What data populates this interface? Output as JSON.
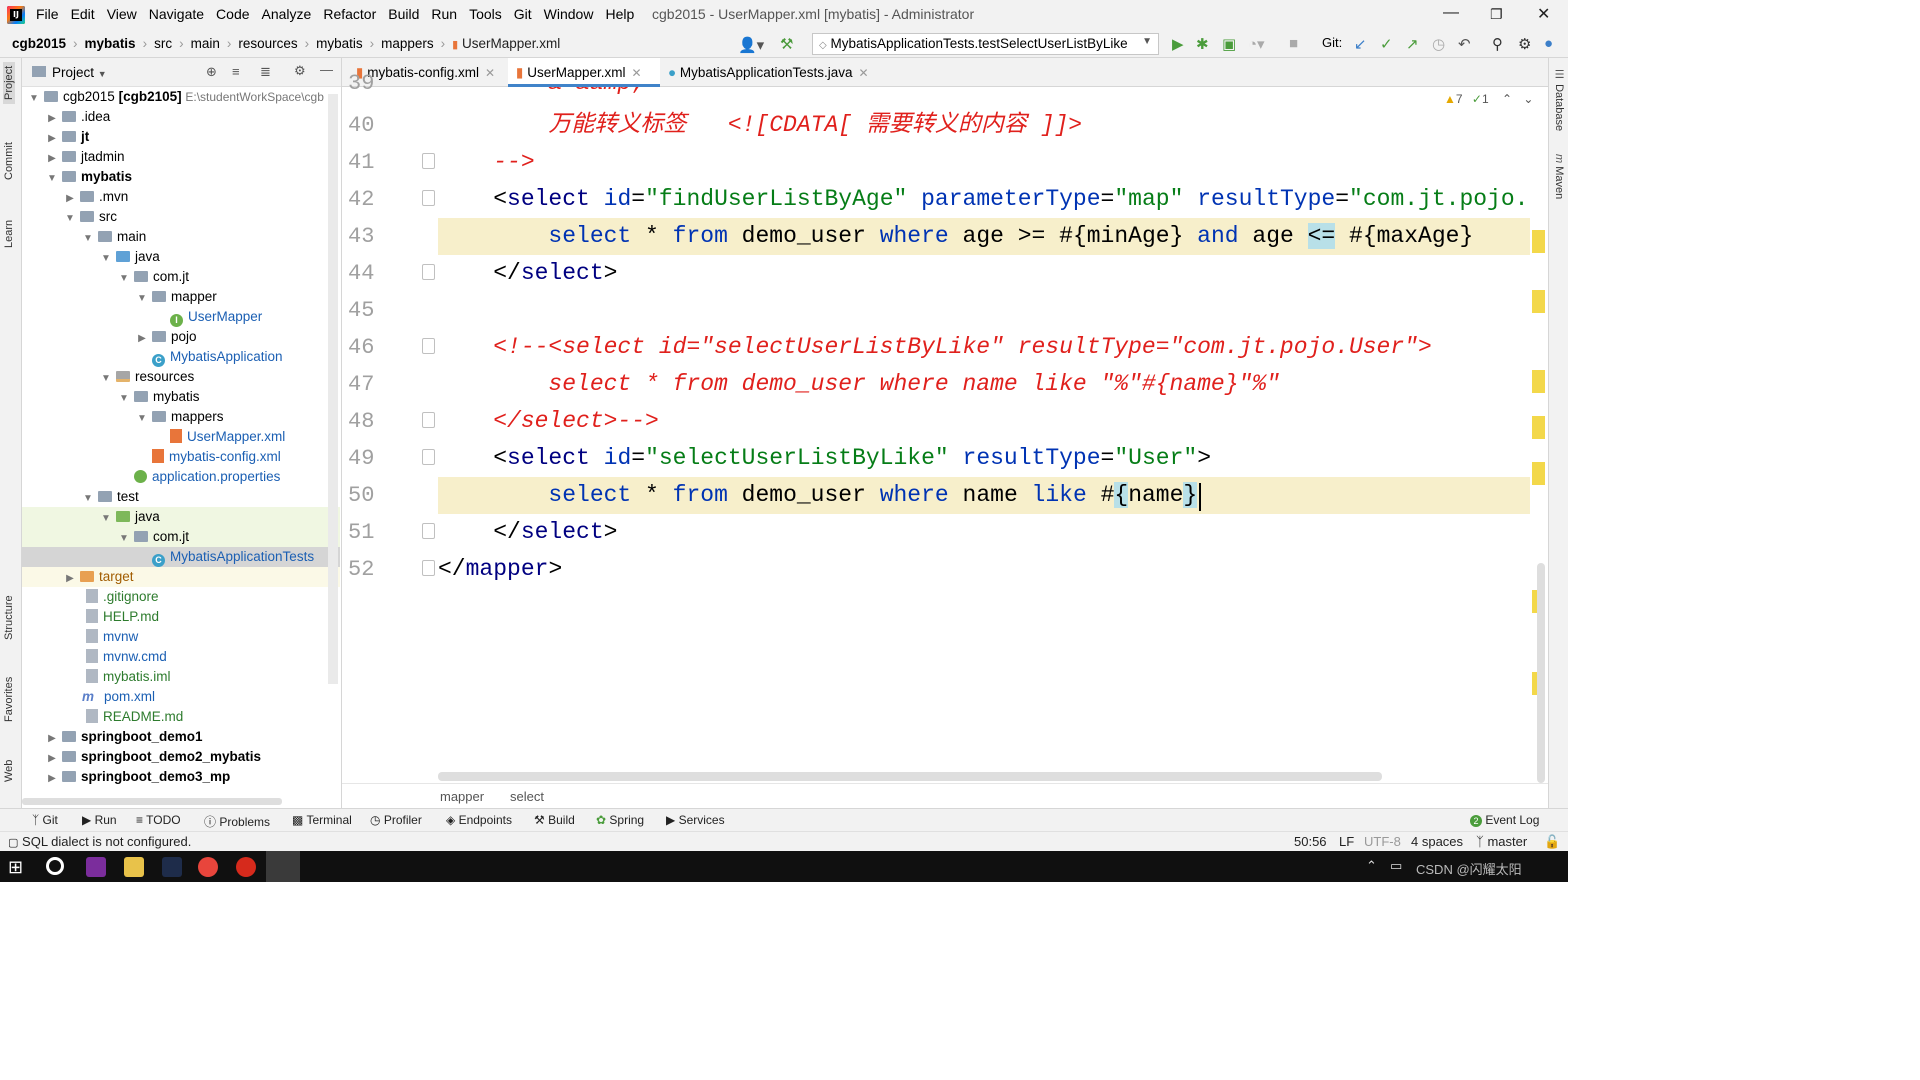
{
  "menubar": {
    "items": [
      "File",
      "Edit",
      "View",
      "Navigate",
      "Code",
      "Analyze",
      "Refactor",
      "Build",
      "Run",
      "Tools",
      "Git",
      "Window",
      "Help"
    ],
    "window_title": "cgb2015 - UserMapper.xml [mybatis] - Administrator"
  },
  "navbar": {
    "crumbs": [
      "cgb2015",
      "mybatis",
      "src",
      "main",
      "resources",
      "mybatis",
      "mappers",
      "UserMapper.xml"
    ],
    "run_config": "MybatisApplicationTests.testSelectUserListByLike",
    "git_label": "Git:"
  },
  "left_strip": [
    "Project",
    "Commit",
    "Learn",
    "Structure",
    "Favorites",
    "Web"
  ],
  "right_strip": [
    "Database",
    "Maven"
  ],
  "project_panel": {
    "title": "Project",
    "tree": [
      {
        "label": "cgb2015",
        "bold_suffix": "[cgb2105]",
        "path": "E:\\studentWorkSpace\\cgb"
      },
      {
        "label": ".idea"
      },
      {
        "label": "jt"
      },
      {
        "label": "jtadmin"
      },
      {
        "label": "mybatis"
      },
      {
        "label": ".mvn"
      },
      {
        "label": "src"
      },
      {
        "label": "main"
      },
      {
        "label": "java"
      },
      {
        "label": "com.jt"
      },
      {
        "label": "mapper"
      },
      {
        "label": "UserMapper"
      },
      {
        "label": "pojo"
      },
      {
        "label": "MybatisApplication"
      },
      {
        "label": "resources"
      },
      {
        "label": "mybatis"
      },
      {
        "label": "mappers"
      },
      {
        "label": "UserMapper.xml"
      },
      {
        "label": "mybatis-config.xml"
      },
      {
        "label": "application.properties"
      },
      {
        "label": "test"
      },
      {
        "label": "java"
      },
      {
        "label": "com.jt"
      },
      {
        "label": "MybatisApplicationTests"
      },
      {
        "label": "target"
      },
      {
        "label": ".gitignore"
      },
      {
        "label": "HELP.md"
      },
      {
        "label": "mvnw"
      },
      {
        "label": "mvnw.cmd"
      },
      {
        "label": "mybatis.iml"
      },
      {
        "label": "pom.xml"
      },
      {
        "label": "README.md"
      },
      {
        "label": "springboot_demo1"
      },
      {
        "label": "springboot_demo2_mybatis"
      },
      {
        "label": "springboot_demo3_mp"
      }
    ]
  },
  "tabs": [
    {
      "label": "mybatis-config.xml"
    },
    {
      "label": "UserMapper.xml"
    },
    {
      "label": "MybatisApplicationTests.java"
    }
  ],
  "editor": {
    "inspections": {
      "warnings": "7",
      "weak": "1"
    },
    "line_numbers": [
      "39",
      "40",
      "41",
      "42",
      "43",
      "44",
      "45",
      "46",
      "47",
      "48",
      "49",
      "50",
      "51",
      "52"
    ],
    "lines": [
      {
        "n": "39",
        "parts": [
          [
            "cms",
            "        & &amp;"
          ]
        ]
      },
      {
        "n": "40",
        "parts": [
          [
            "cms",
            "        万能转义标签   <![CDATA[ 需要转义的内容 ]]>"
          ]
        ]
      },
      {
        "n": "41",
        "parts": [
          [
            "cm",
            "    -->"
          ]
        ]
      },
      {
        "n": "42",
        "parts": [
          [
            "t",
            "    <"
          ],
          [
            "k",
            "select "
          ],
          [
            "a",
            "id"
          ],
          [
            "t",
            "="
          ],
          [
            "s",
            "\"findUserListByAge\" "
          ],
          [
            "a",
            "parameterType"
          ],
          [
            "t",
            "="
          ],
          [
            "s",
            "\"map\" "
          ],
          [
            "a",
            "resultType"
          ],
          [
            "t",
            "="
          ],
          [
            "s",
            "\"com.jt.pojo.U"
          ]
        ]
      },
      {
        "n": "43",
        "parts": [
          [
            "t",
            "        "
          ],
          [
            "kw",
            "select "
          ],
          [
            "t",
            "* "
          ],
          [
            "kw",
            "from "
          ],
          [
            "t",
            "demo_user "
          ],
          [
            "kw",
            "where "
          ],
          [
            "t",
            "age >= #{minAge} "
          ],
          [
            "kw",
            "and "
          ],
          [
            "t",
            "age "
          ],
          [
            "hlp",
            "<="
          ],
          [
            "t",
            " #{maxAge}"
          ]
        ]
      },
      {
        "n": "44",
        "parts": [
          [
            "t",
            "    </"
          ],
          [
            "k",
            "select"
          ],
          [
            "t",
            ">"
          ]
        ]
      },
      {
        "n": "45",
        "parts": [
          [
            "t",
            ""
          ]
        ]
      },
      {
        "n": "46",
        "parts": [
          [
            "cm",
            "    <!--<select id=\"selectUserListByLike\" resultType=\"com.jt.pojo.User\">"
          ]
        ]
      },
      {
        "n": "47",
        "parts": [
          [
            "cm",
            "        select * from demo_user where name like \"%\"#{name}\"%\""
          ]
        ]
      },
      {
        "n": "48",
        "parts": [
          [
            "cm",
            "    </select>-->"
          ]
        ]
      },
      {
        "n": "49",
        "parts": [
          [
            "t",
            "    <"
          ],
          [
            "k",
            "select "
          ],
          [
            "a",
            "id"
          ],
          [
            "t",
            "="
          ],
          [
            "s",
            "\"selectUserListByLike\" "
          ],
          [
            "a",
            "resultType"
          ],
          [
            "t",
            "="
          ],
          [
            "s",
            "\"User\""
          ],
          [
            "t",
            ">"
          ]
        ]
      },
      {
        "n": "50",
        "parts": [
          [
            "t",
            "        "
          ],
          [
            "kw",
            "select "
          ],
          [
            "t",
            "* "
          ],
          [
            "kw",
            "from "
          ],
          [
            "t",
            "demo_user "
          ],
          [
            "kw",
            "where "
          ],
          [
            "t",
            "name "
          ],
          [
            "kw",
            "like "
          ],
          [
            "t",
            "#"
          ],
          [
            "hlp",
            "{"
          ],
          [
            "t",
            "name"
          ],
          [
            "hlp",
            "}"
          ]
        ]
      },
      {
        "n": "51",
        "parts": [
          [
            "t",
            "    </"
          ],
          [
            "k",
            "select"
          ],
          [
            "t",
            ">"
          ]
        ]
      },
      {
        "n": "52",
        "parts": [
          [
            "t",
            "</"
          ],
          [
            "k",
            "mapper"
          ],
          [
            "t",
            ">"
          ]
        ]
      }
    ],
    "breadcrumb": [
      "mapper",
      "select"
    ]
  },
  "toolwindows": [
    "Git",
    "Run",
    "TODO",
    "Problems",
    "Terminal",
    "Profiler",
    "Endpoints",
    "Build",
    "Spring",
    "Services"
  ],
  "event_log": {
    "count": "2",
    "label": "Event Log"
  },
  "status": {
    "message": "SQL dialect is not configured.",
    "position": "50:56",
    "line_sep": "LF",
    "encoding": "UTF-8",
    "indent": "4 spaces",
    "branch": "master"
  },
  "taskbar": {
    "watermark": "CSDN @闪耀太阳"
  }
}
